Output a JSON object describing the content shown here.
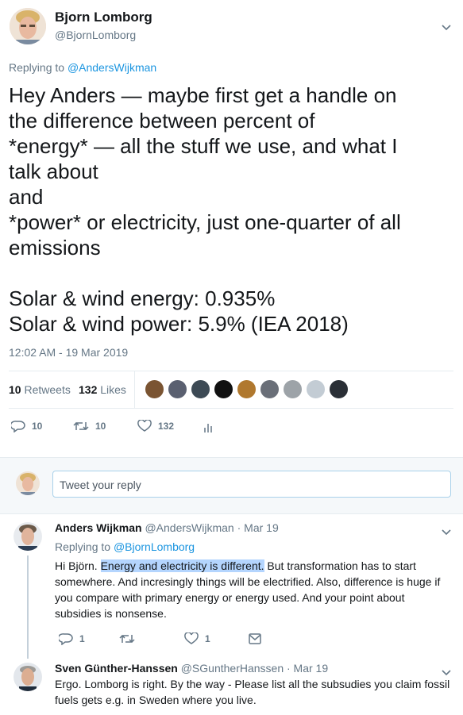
{
  "main": {
    "author_name": "Bjorn Lomborg",
    "author_handle": "@BjornLomborg",
    "replying_prefix": "Replying to",
    "replying_to": "@AndersWijkman",
    "lines": [
      "Hey Anders — maybe first get a handle on",
      "the difference between percent of",
      "*energy* — all the stuff we use, and what I",
      "talk about",
      "and",
      "*power* or electricity, just one-quarter of all",
      "emissions",
      "",
      "Solar & wind energy: 0.935%",
      "Solar & wind power: 5.9% (IEA 2018)"
    ],
    "timestamp": "12:02 AM - 19 Mar 2019",
    "retweets_count": "10",
    "retweets_label": "Retweets",
    "likes_count": "132",
    "likes_label": "Likes",
    "actions": {
      "reply": "10",
      "retweet": "10",
      "like": "132"
    }
  },
  "reply_box": {
    "placeholder": "Tweet your reply"
  },
  "replies": [
    {
      "name": "Anders Wijkman",
      "handle": "@AndersWijkman",
      "date": "· Mar 19",
      "replying_prefix": "Replying to",
      "replying_to": "@BjornLomborg",
      "text_pre": "Hi Björn. ",
      "text_highlight": "Energy and electricity is different.",
      "text_post": " But transformation has to start somewhere. And incresingly things will be electrified. Also, difference is huge if you compare with primary energy or energy used. And your point about subsidies is nonsense.",
      "reply_count": "1",
      "like_count": "1"
    },
    {
      "name": "Sven Günther-Hanssen",
      "handle": "@SGuntherHanssen",
      "date": "· Mar 19",
      "text": "Ergo. Lomborg is right. By the way - Please list all the subsudies you claim fossil fuels gets e.g. in Sweden where you live."
    }
  ],
  "colors": {
    "accent": "#1b95e0",
    "muted": "#657786",
    "divider": "#e6ecf0",
    "highlight": "#b4d5fe"
  },
  "icons": [
    "chevron-down-icon",
    "reply-icon",
    "retweet-icon",
    "heart-icon",
    "analytics-icon",
    "dm-icon"
  ]
}
